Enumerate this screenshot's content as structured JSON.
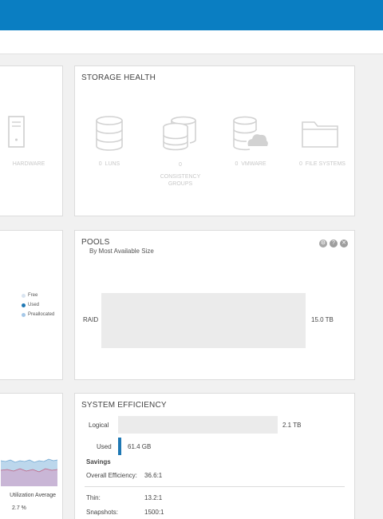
{
  "storage_health": {
    "title": "STORAGE HEALTH",
    "items": [
      {
        "count": "0",
        "label": "LUNS"
      },
      {
        "count": "0",
        "label": "CONSISTENCY GROUPS"
      },
      {
        "count": "0",
        "label": "VMWARE"
      },
      {
        "count": "0",
        "label": "FILE SYSTEMS"
      }
    ]
  },
  "hardware": {
    "label": "HARDWARE"
  },
  "capacity_legend": {
    "free": "Free",
    "used": "Used",
    "preallocated": "Preallocated",
    "colors": {
      "free": "#c9d6e6",
      "used": "#1f78b4",
      "preallocated": "#a6c8e8"
    }
  },
  "pools": {
    "title": "POOLS",
    "subtitle": "By Most Available Size",
    "items": [
      {
        "name": "RAID",
        "size": "15.0 TB",
        "used_fraction": 0.0
      }
    ]
  },
  "performance": {
    "label": "Utilization Average",
    "value": "2.7 %"
  },
  "system_efficiency": {
    "title": "SYSTEM EFFICIENCY",
    "logical_label": "Logical",
    "logical_value": "2.1 TB",
    "used_label": "Used",
    "used_value": "61.4 GB",
    "savings_label": "Savings",
    "overall_label": "Overall Efficiency:",
    "overall_value": "36.6:1",
    "thin_label": "Thin:",
    "thin_value": "13.2:1",
    "snapshots_label": "Snapshots:",
    "snapshots_value": "1500:1"
  },
  "colors": {
    "accent": "#0a7ec2",
    "used_bar": "#1f78b4"
  }
}
